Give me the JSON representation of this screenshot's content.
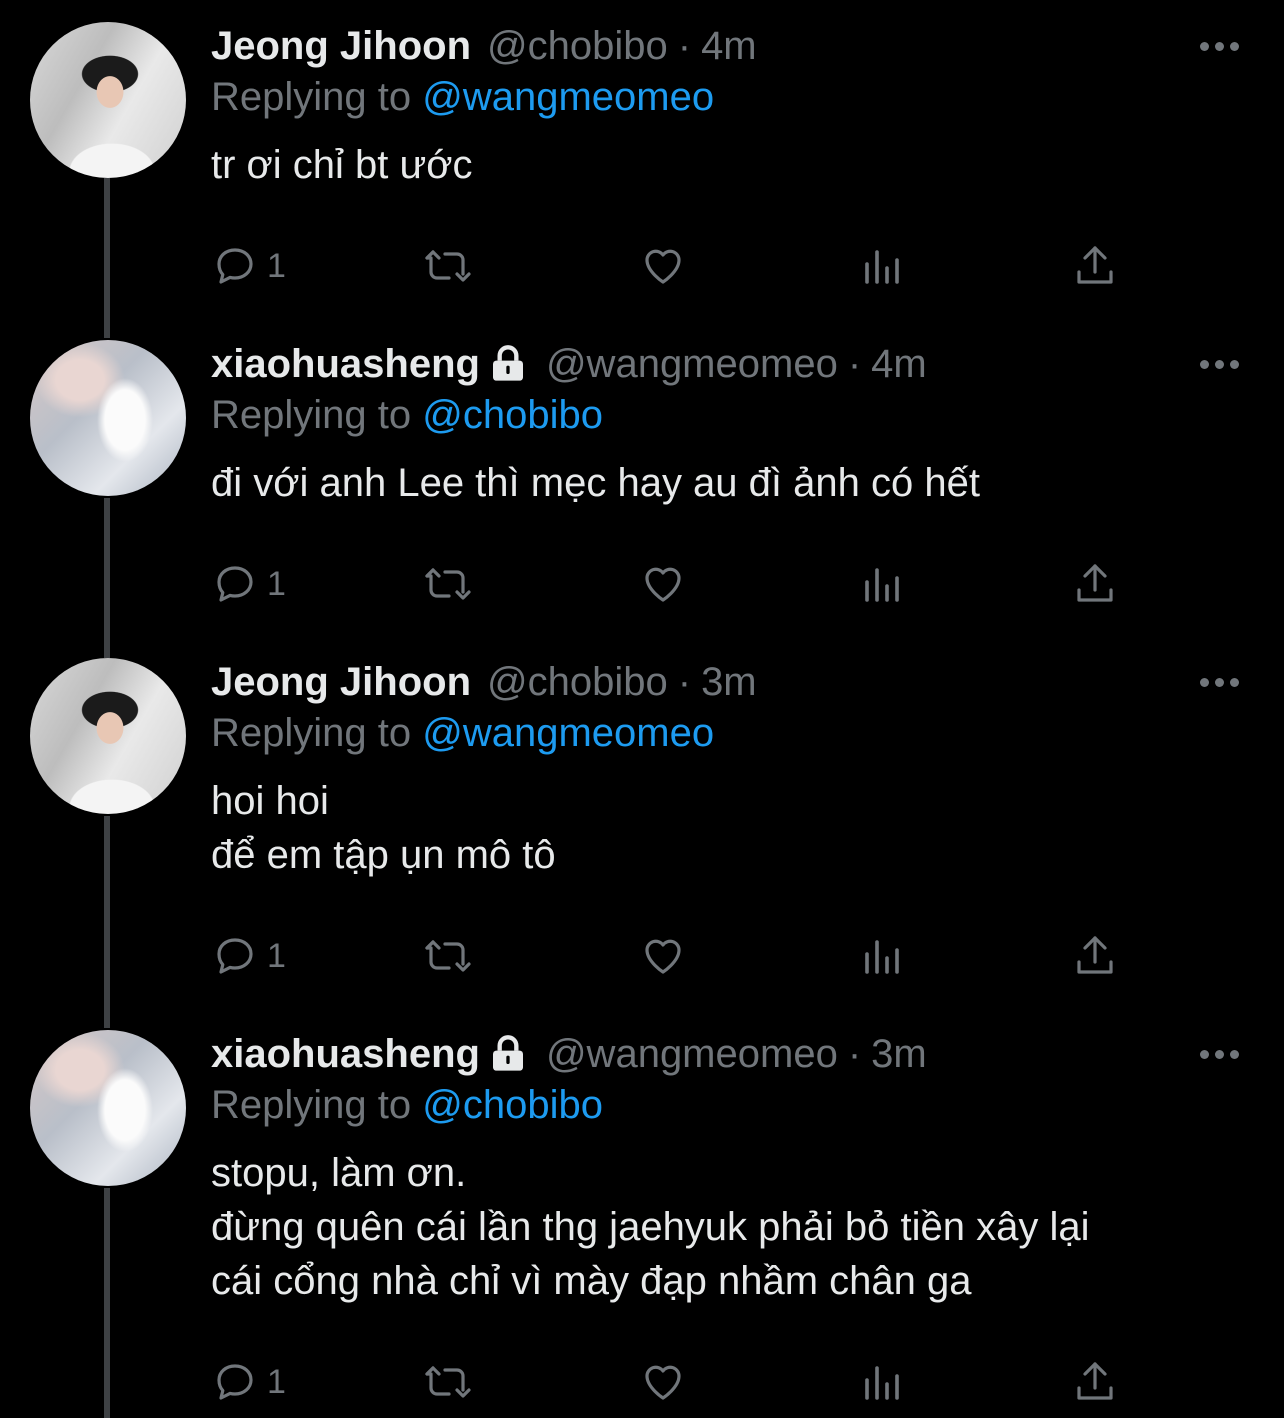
{
  "tweets": [
    {
      "avatar_alt": "Jeong Jihoon avatar",
      "name": "Jeong Jihoon",
      "locked": false,
      "handle": "@chobibo",
      "separator": "·",
      "time": "4m",
      "replying_prefix": "Replying to",
      "replying_to": "@wangmeomeo",
      "text_lines": [
        "tr ơi chỉ bt ước"
      ],
      "reply_count": "1"
    },
    {
      "avatar_alt": "xiaohuasheng avatar",
      "name": "xiaohuasheng",
      "locked": true,
      "handle": "@wangmeomeo",
      "separator": "·",
      "time": "4m",
      "replying_prefix": "Replying to",
      "replying_to": "@chobibo",
      "text_lines": [
        "đi với anh Lee thì mẹc hay au đì ảnh có hết"
      ],
      "reply_count": "1"
    },
    {
      "avatar_alt": "Jeong Jihoon avatar",
      "name": "Jeong Jihoon",
      "locked": false,
      "handle": "@chobibo",
      "separator": "·",
      "time": "3m",
      "replying_prefix": "Replying to",
      "replying_to": "@wangmeomeo",
      "text_lines": [
        "hoi hoi",
        "để em tập ụn mô tô"
      ],
      "reply_count": "1"
    },
    {
      "avatar_alt": "xiaohuasheng avatar",
      "name": "xiaohuasheng",
      "locked": true,
      "handle": "@wangmeomeo",
      "separator": "·",
      "time": "3m",
      "replying_prefix": "Replying to",
      "replying_to": "@chobibo",
      "text_lines": [
        "stopu, làm ơn.",
        "đừng quên cái lần thg jaehyuk phải bỏ tiền xây lại",
        "cái cổng nhà chỉ vì mày đạp nhầm chân ga"
      ],
      "reply_count": "1"
    }
  ],
  "colors": {
    "background": "#000000",
    "text": "#e7e9ea",
    "secondary": "#71767b",
    "mention": "#1d9bf0",
    "thread_line": "#3e4144"
  },
  "icons": [
    "reply-icon",
    "retweet-icon",
    "like-icon",
    "analytics-icon",
    "share-icon",
    "more-icon",
    "lock-icon"
  ]
}
